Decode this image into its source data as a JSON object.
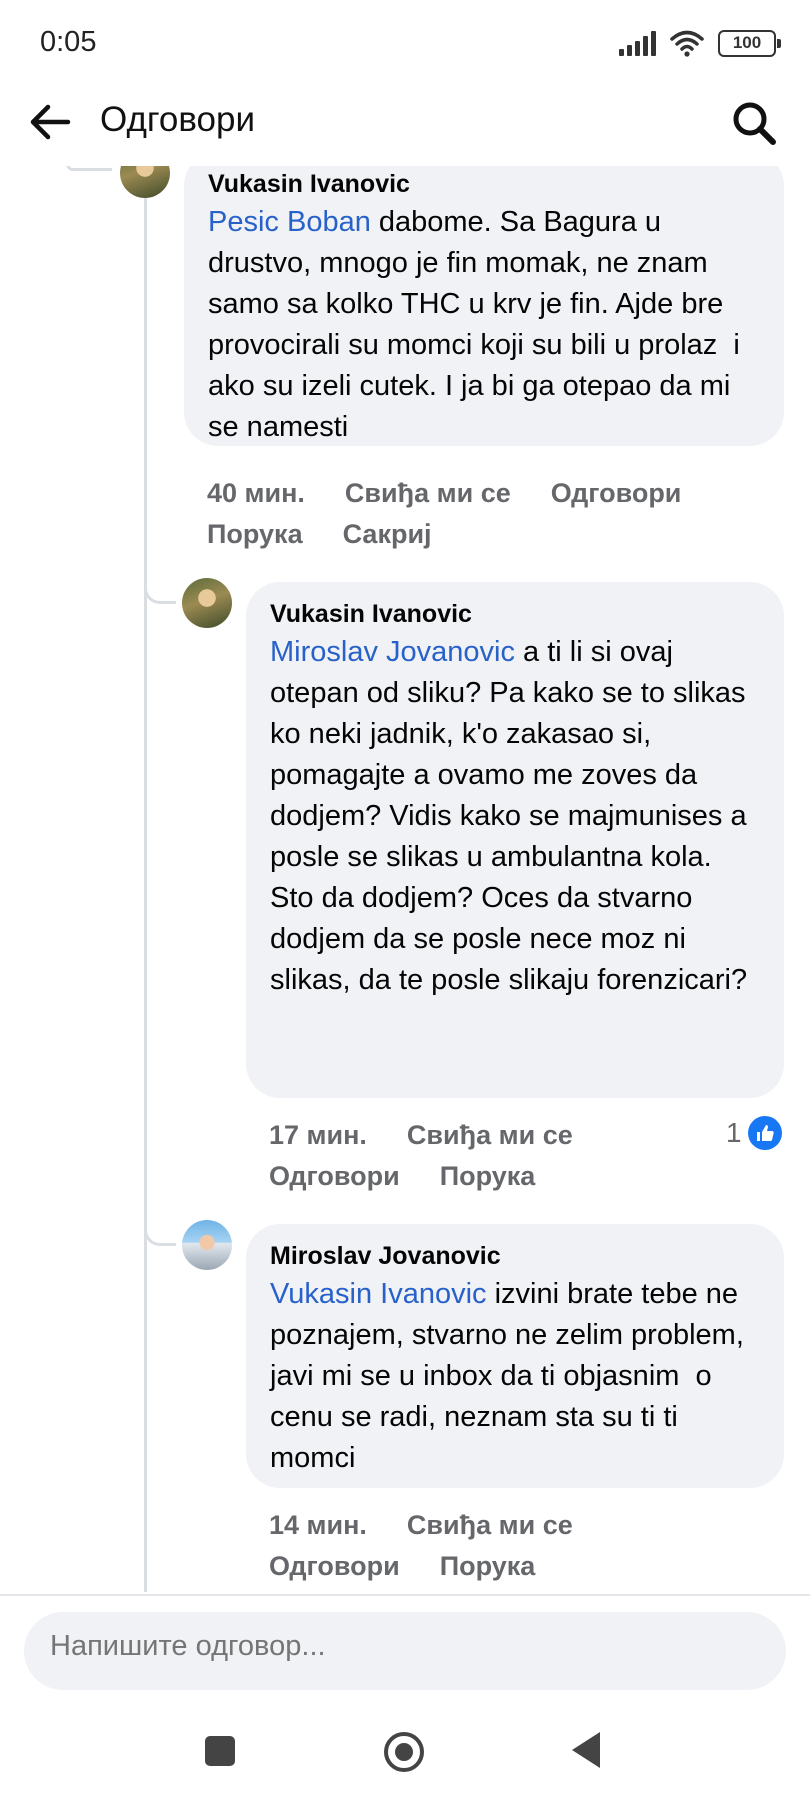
{
  "status": {
    "time": "0:05",
    "battery": "100"
  },
  "header": {
    "title": "Одговори"
  },
  "comments": [
    {
      "author": "Vukasin Ivanovic",
      "mention": "Pesic Boban",
      "text": " dabome. Sa Bagura u drustvo, mnogo je fin momak, ne znam samo sa kolko THC u krv je fin. Ajde bre provocirali su momci koji su bili u prolaz  i ako su izeli cutek. I ja bi ga otepao da mi se namesti",
      "time": "40 мин.",
      "like_label": "Свиђа ми се",
      "reply_label": "Одговори",
      "message_label": "Порука",
      "hide_label": "Сакриј"
    },
    {
      "author": "Vukasin Ivanovic",
      "mention": "Miroslav Jovanovic",
      "text": " a ti li si ovaj otepan od sliku? Pa kako se to slikas ko neki jadnik, k'o zakasao si, pomagajte a ovamo me zoves da dodjem? Vidis kako se majmunises a posle se slikas u ambulantna kola.\nSto da dodjem? Oces da stvarno dodjem da se posle nece moz ni slikas, da te posle slikaju forenzicari?",
      "time": "17 мин.",
      "like_label": "Свиђа ми се",
      "reply_label": "Одговори",
      "message_label": "Порука",
      "reaction_count": "1"
    },
    {
      "author": "Miroslav Jovanovic",
      "mention": "Vukasin Ivanovic",
      "text": " izvini brate tebe ne poznajem, stvarno ne zelim problem, javi mi se u inbox da ti objasnim  o cenu se radi, neznam sta su ti ti momci",
      "time": "14 мин.",
      "like_label": "Свиђа ми се",
      "reply_label": "Одговори",
      "message_label": "Порука"
    }
  ],
  "composer": {
    "placeholder": "Напишите одговор..."
  },
  "colors": {
    "mention": "#2862c9",
    "bubble": "#f0f2f5",
    "meta": "#65676b",
    "like": "#1877f2"
  },
  "icons": [
    "back-arrow-icon",
    "search-icon",
    "like-icon",
    "recents-icon",
    "home-icon",
    "nav-back-icon",
    "wifi-icon",
    "signal-icon",
    "battery-icon"
  ]
}
